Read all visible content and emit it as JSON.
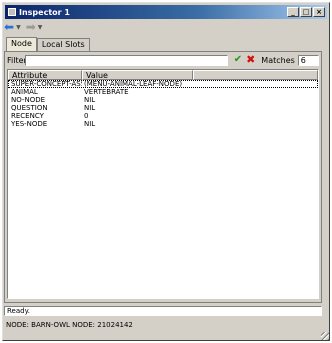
{
  "window": {
    "title": "Inspector 1"
  },
  "title_buttons": {
    "minimize": "_",
    "maximize": "□",
    "close": "×"
  },
  "toolbar": {
    "back_icon": "back-arrow",
    "forward_icon": "forward-arrow"
  },
  "tabs": [
    {
      "label": "Node",
      "active": true
    },
    {
      "label": "Local Slots",
      "active": false
    }
  ],
  "filter": {
    "label": "Filter",
    "value": "",
    "matches_label": "Matches",
    "matches_value": "6"
  },
  "grid": {
    "columns": [
      "Attribute",
      "Value",
      ""
    ],
    "rows": [
      {
        "attribute": "SUPER-CONCEPT-ASSIGN",
        "value": "(MENU-ANIMAL-LEAF-NODE)",
        "selected": true
      },
      {
        "attribute": "ANIMAL",
        "value": "VERTEBRATE",
        "selected": false
      },
      {
        "attribute": "NO-NODE",
        "value": "NIL",
        "selected": false
      },
      {
        "attribute": "QUESTION",
        "value": "NIL",
        "selected": false
      },
      {
        "attribute": "RECENCY",
        "value": "0",
        "selected": false
      },
      {
        "attribute": "YES-NODE",
        "value": "NIL",
        "selected": false
      }
    ]
  },
  "status": {
    "line1": "Ready.",
    "line2": "NODE: BARN-OWL  NODE: 21024142"
  },
  "colors": {
    "titlebar_start": "#0a246a",
    "titlebar_end": "#a6caf0",
    "face": "#d4d0c8",
    "check": "#1a9a1a",
    "clear": "#d01010"
  }
}
